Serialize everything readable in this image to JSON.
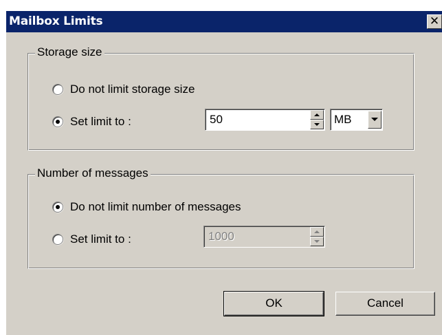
{
  "window": {
    "title": "Mailbox Limits",
    "close_glyph": "✕"
  },
  "storage": {
    "legend": "Storage size",
    "option_no_limit": "Do not limit storage size",
    "option_set_limit": "Set limit to :",
    "selected": "set_limit",
    "limit_value": "50",
    "unit_selected": "MB",
    "unit_icon": "chevron-down-icon"
  },
  "messages": {
    "legend": "Number of messages",
    "option_no_limit": "Do not limit number of messages",
    "option_set_limit": "Set limit to :",
    "selected": "no_limit",
    "limit_value": "1000",
    "limit_enabled": false
  },
  "buttons": {
    "ok_label": "OK",
    "cancel_label": "Cancel"
  },
  "colors": {
    "title_bar": "#0a246a",
    "dialog_face": "#d4d0c8"
  }
}
